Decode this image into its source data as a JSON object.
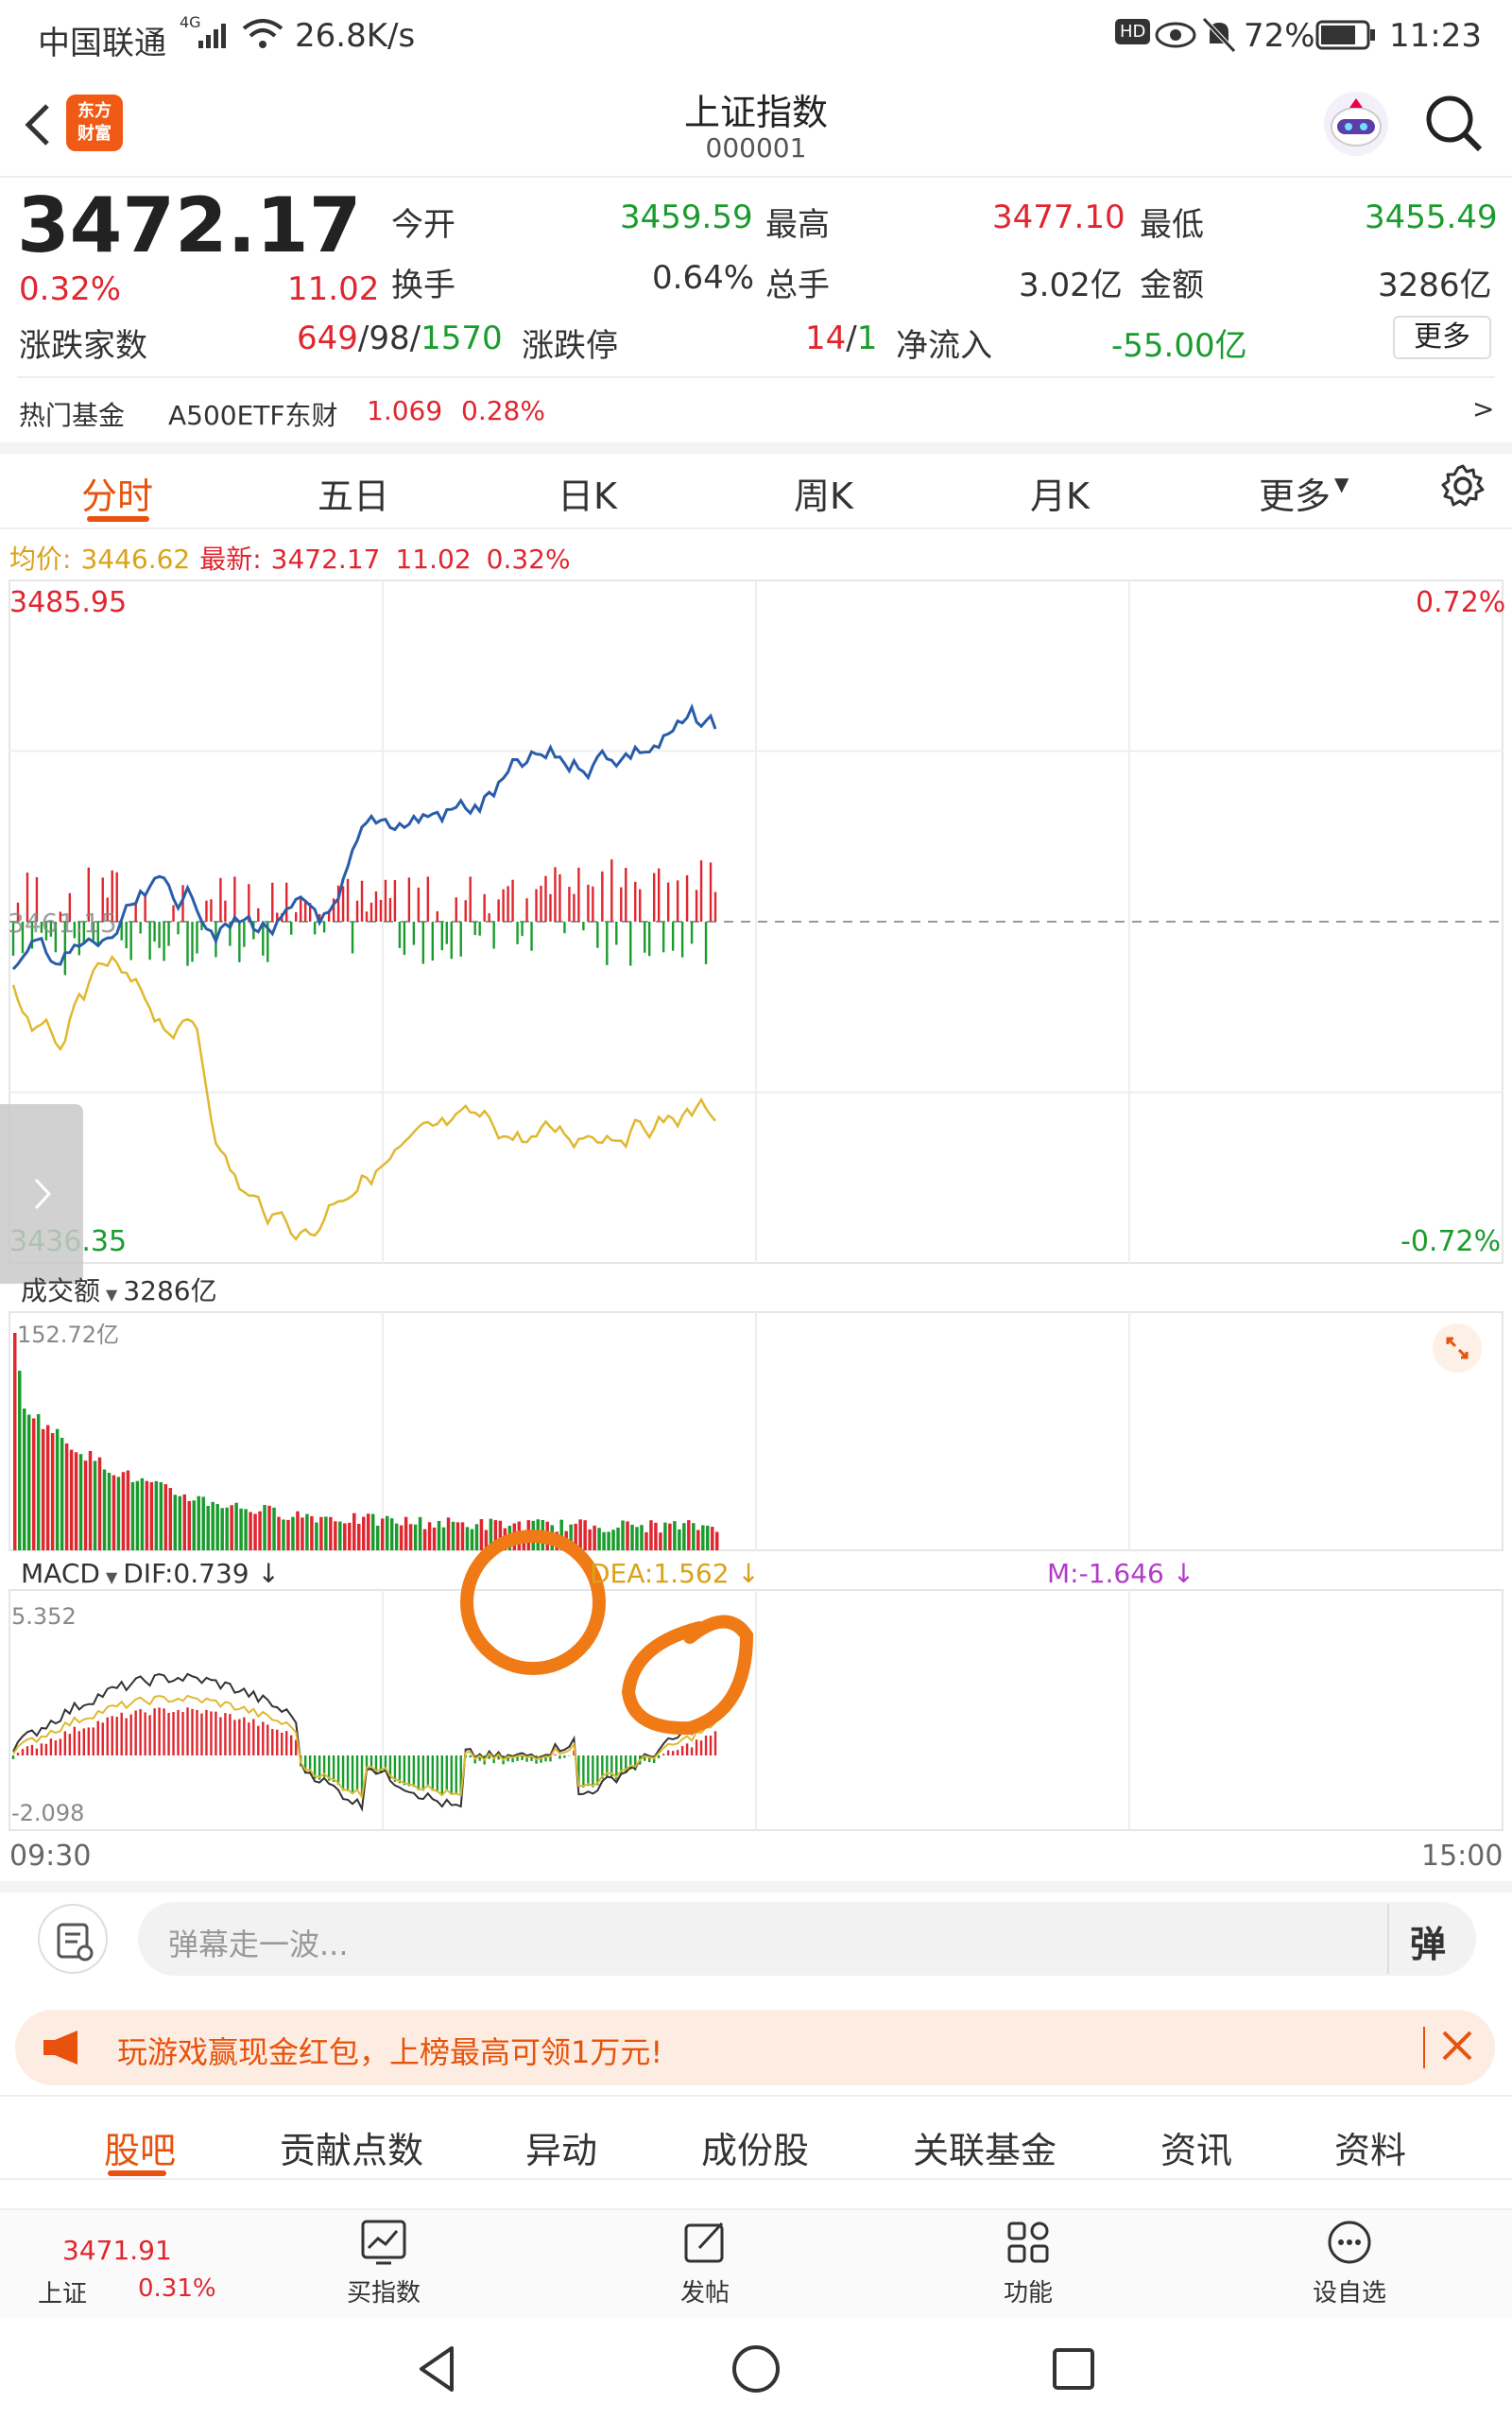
{
  "status": {
    "carrier": "中国联通",
    "network": "4G",
    "speed": "26.8K/s",
    "hd": "HD",
    "battery": "72%",
    "time": "11:23"
  },
  "header": {
    "title": "上证指数",
    "code": "000001",
    "logo_text": "东方财富"
  },
  "quote": {
    "price": "3472.17",
    "pct": "0.32%",
    "change": "11.02",
    "open_label": "今开",
    "open": "3459.59",
    "high_label": "最高",
    "high": "3477.10",
    "low_label": "最低",
    "low": "3455.49",
    "turnover_label": "换手",
    "turnover": "0.64%",
    "total_hand_label": "总手",
    "total_hand": "3.02亿",
    "amount_label": "金额",
    "amount": "3286亿",
    "breadth_label": "涨跌家数",
    "breadth_up": "649",
    "breadth_flat": "98",
    "breadth_down": "1570",
    "sep": "/",
    "limit_label": "涨跌停",
    "limit_up": "14",
    "limit_down": "1",
    "netflow_label": "净流入",
    "netflow": "-55.00亿",
    "more": "更多"
  },
  "fund": {
    "label": "热门基金",
    "name": "A500ETF东财",
    "price": "1.069",
    "pct": "0.28%",
    "arrow": ">"
  },
  "chart_tabs": [
    "分时",
    "五日",
    "日K",
    "周K",
    "月K",
    "更多"
  ],
  "info_line": {
    "avg_label": "均价:",
    "avg": "3446.62",
    "latest_label": "最新:",
    "latest": "3472.17",
    "change": "11.02",
    "pct": "0.32%"
  },
  "price_axis": {
    "top": "3485.95",
    "bottom": "3436.35",
    "mid": "3461.15",
    "top_pct": "0.72%",
    "bottom_pct": "-0.72%"
  },
  "volume": {
    "label": "成交额",
    "value": "3286亿",
    "max": "152.72亿"
  },
  "macd": {
    "label": "MACD",
    "dif": "DIF:0.739",
    "dea": "DEA:1.562",
    "m": "M:-1.646",
    "max": "5.352",
    "min": "-2.098"
  },
  "time_axis": {
    "start": "09:30",
    "end": "15:00"
  },
  "danmu": {
    "placeholder": "弹幕走一波...",
    "btn": "弹"
  },
  "promo": {
    "text": "玩游戏赢现金红包，上榜最高可领1万元!"
  },
  "bottom_tabs": [
    "股吧",
    "贡献点数",
    "异动",
    "成份股",
    "关联基金",
    "资讯",
    "资料"
  ],
  "bottom_nav": {
    "index_price": "3471.91",
    "index_name": "上证",
    "index_pct": "0.31%",
    "buy": "买指数",
    "post": "发帖",
    "func": "功能",
    "watch": "设自选"
  },
  "colors": {
    "accent": "#e8520c",
    "red": "#e0262f",
    "green": "#1a9c2d",
    "price_line": "#2a5caa",
    "avg_line": "#e0b830"
  }
}
